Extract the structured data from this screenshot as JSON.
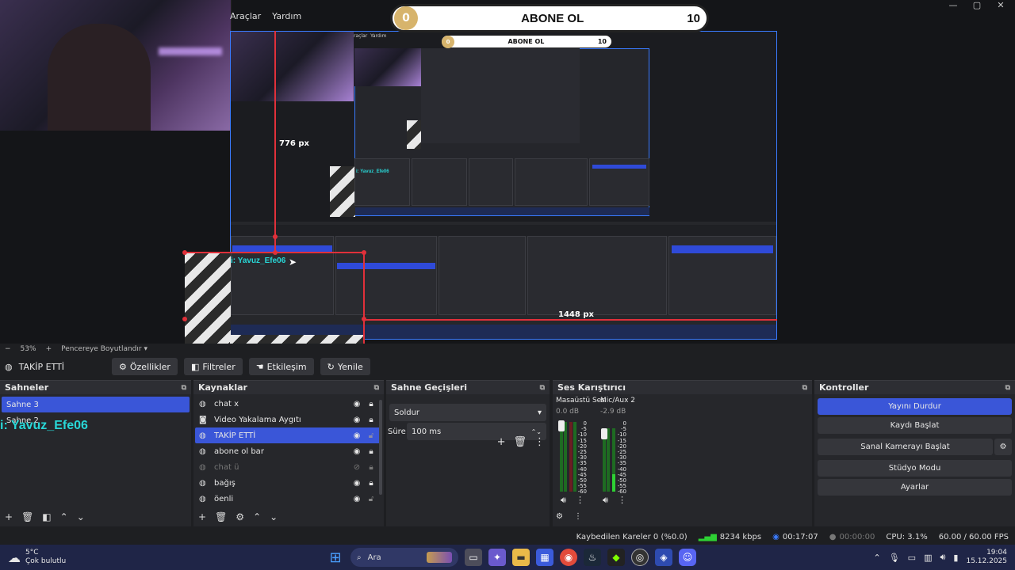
{
  "menu": [
    "Araçlar",
    "Yardım"
  ],
  "window_controls": {
    "minimize": "—",
    "maximize": "▢",
    "close": "✕"
  },
  "banner": {
    "left": "0",
    "title": "ABONE OL",
    "right": "10"
  },
  "nested_banner": {
    "left": "0",
    "title": "ABONE OL",
    "right": "10"
  },
  "nested_menu": [
    "raçlar",
    "Yardım"
  ],
  "canvas_labels": {
    "height_label": "776 px",
    "width_label": "1448 px",
    "overlay_text": "i: Yavuz_Efe06",
    "overlay_text_nested": "i: Yavuz_Efe06"
  },
  "zoom": {
    "minus": "−",
    "level": "53%",
    "plus": "+",
    "mode": "Pencereye Boyutlandır"
  },
  "source_toolbar": {
    "selected_source": "TAKİP ETTİ",
    "buttons": [
      "Özellikler",
      "Filtreler",
      "Etkileşim",
      "Yenile"
    ]
  },
  "scenes": {
    "title": "Sahneler",
    "items": [
      "Sahne 3",
      "Sahne 2"
    ],
    "selected": 0,
    "overlay_text": "i: Yavuz_Efe06"
  },
  "sources": {
    "title": "Kaynaklar",
    "items": [
      {
        "label": "chat x",
        "icon": "browser",
        "visible": true,
        "locked": true
      },
      {
        "label": "Video Yakalama Aygıtı",
        "icon": "camera",
        "visible": true,
        "locked": true
      },
      {
        "label": "TAKİP ETTİ",
        "icon": "browser",
        "visible": true,
        "locked": false,
        "selected": true
      },
      {
        "label": "abone ol bar",
        "icon": "browser",
        "visible": true,
        "locked": true
      },
      {
        "label": "chat ü",
        "icon": "browser",
        "visible": false,
        "locked": true
      },
      {
        "label": "bağış",
        "icon": "browser",
        "visible": true,
        "locked": true
      },
      {
        "label": "öenli",
        "icon": "browser",
        "visible": true,
        "locked": false
      }
    ]
  },
  "transitions": {
    "title": "Sahne Geçişleri",
    "selected": "Soldur",
    "duration_label": "Süre",
    "duration_value": "100 ms"
  },
  "mixer": {
    "title": "Ses Karıştırıcı",
    "channels": [
      {
        "name": "Masaüstü Ses",
        "db": "0.0 dB"
      },
      {
        "name": "Mic/Aux 2",
        "db": "-2.9 dB"
      }
    ],
    "scale": [
      "0",
      "-5",
      "-10",
      "-15",
      "-20",
      "-25",
      "-30",
      "-35",
      "-40",
      "-45",
      "-50",
      "-55",
      "-60"
    ]
  },
  "controls": {
    "title": "Kontroller",
    "buttons": [
      "Yayını Durdur",
      "Kaydı Başlat",
      "Sanal Kamerayı Başlat",
      "Stüdyo Modu",
      "Ayarlar"
    ]
  },
  "status": {
    "dropped": "Kaybedilen Kareler 0 (%0.0)",
    "bitrate": "8234 kbps",
    "stream_time": "00:17:07",
    "rec_time": "00:00:00",
    "cpu": "CPU: 3.1%",
    "fps": "60.00 / 60.00 FPS"
  },
  "taskbar": {
    "weather_temp": "5°C",
    "weather_desc": "Çok bulutlu",
    "search_placeholder": "Ara",
    "time": "19:04",
    "date": "15.12.2025"
  },
  "colors": {
    "accent": "#3a56d8",
    "selection_border": "#3a7bff",
    "guide_red": "#e0303a",
    "overlay_cyan": "#28d7d7"
  }
}
